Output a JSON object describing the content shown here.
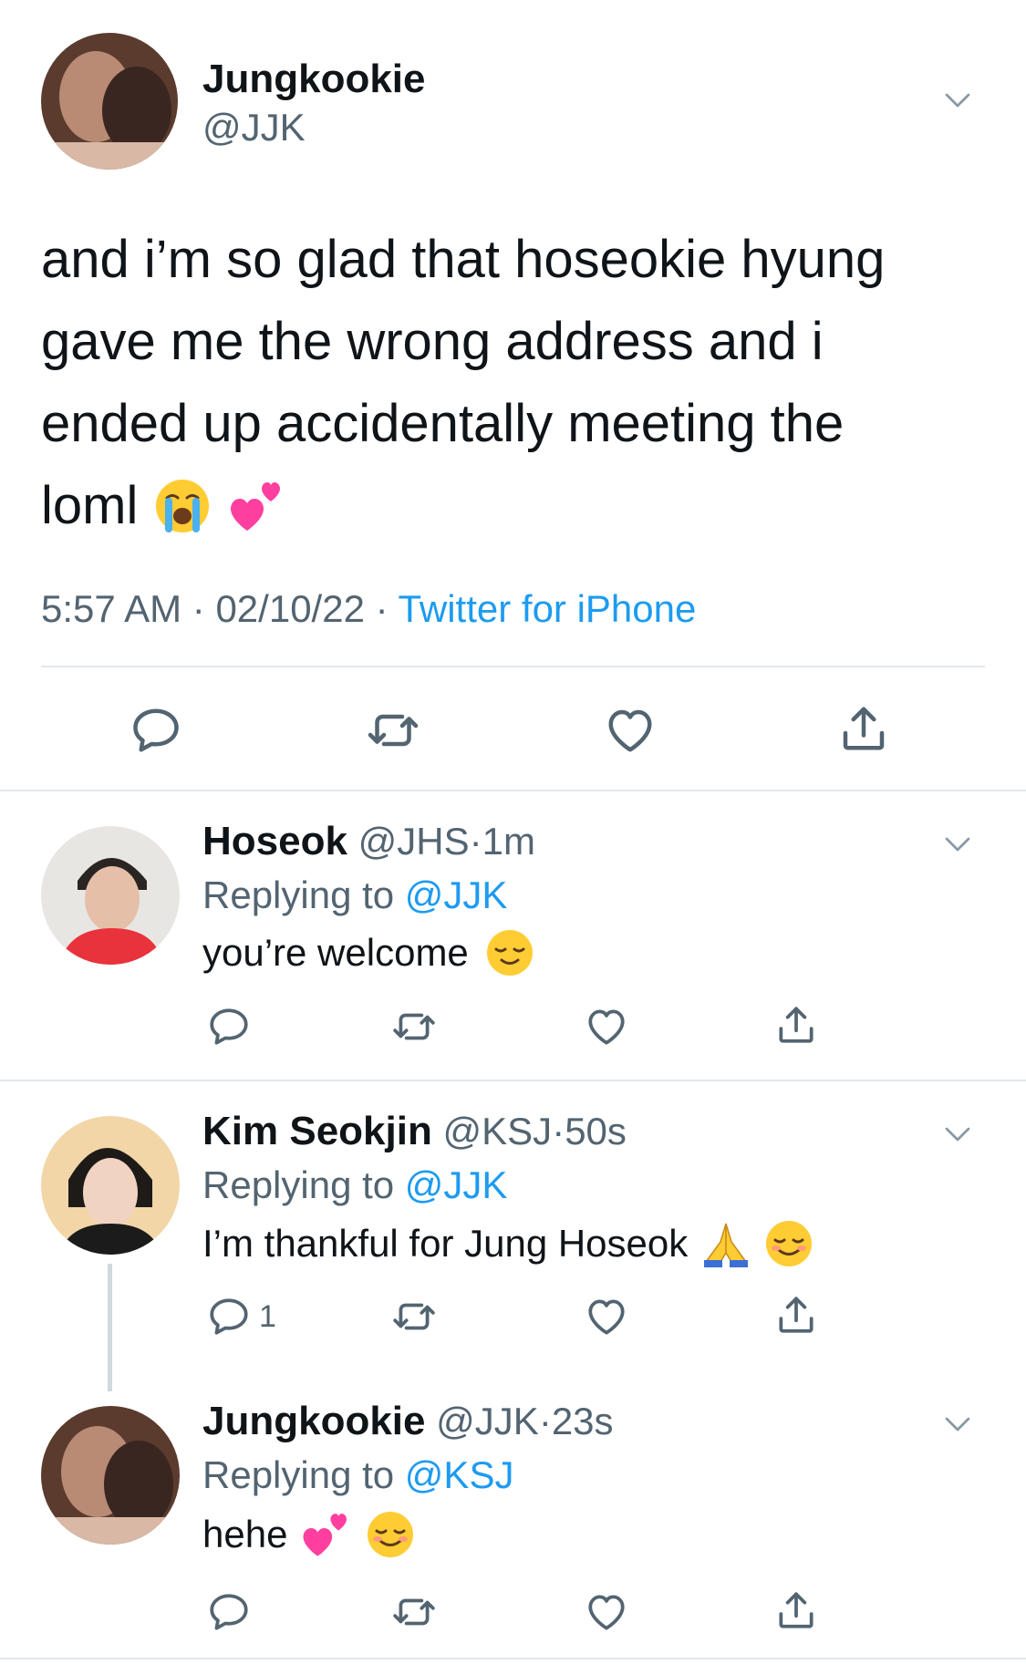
{
  "main_tweet": {
    "display_name": "Jungkookie",
    "handle": "@JJK",
    "text_lines": [
      "and i’m so glad that hoseokie hyung",
      "gave me the wrong address and i",
      "ended up accidentally meeting the",
      "loml"
    ],
    "time": "5:57 AM",
    "date": "02/10/22",
    "sep": "·",
    "source": "Twitter for iPhone"
  },
  "replies": [
    {
      "display_name": "Hoseok",
      "handle": "@JHS",
      "age": "1m",
      "replying_label": "Replying to",
      "replying_to": "@JJK",
      "text": "you’re welcome",
      "reply_count": ""
    },
    {
      "display_name": "Kim Seokjin",
      "handle": "@KSJ",
      "age": "50s",
      "replying_label": "Replying to",
      "replying_to": "@JJK",
      "text": "I’m thankful for Jung Hoseok",
      "reply_count": "1"
    },
    {
      "display_name": "Jungkookie",
      "handle": "@JJK",
      "age": "23s",
      "replying_label": "Replying to",
      "replying_to": "@KSJ",
      "text": "hehe",
      "reply_count": ""
    }
  ],
  "colors": {
    "link": "#1d9bf0",
    "muted": "#536471",
    "icon": "#536471",
    "divider": "#e1e8ed"
  },
  "icons": [
    "chevron-down-icon",
    "reply-icon",
    "retweet-icon",
    "like-icon",
    "share-icon"
  ]
}
